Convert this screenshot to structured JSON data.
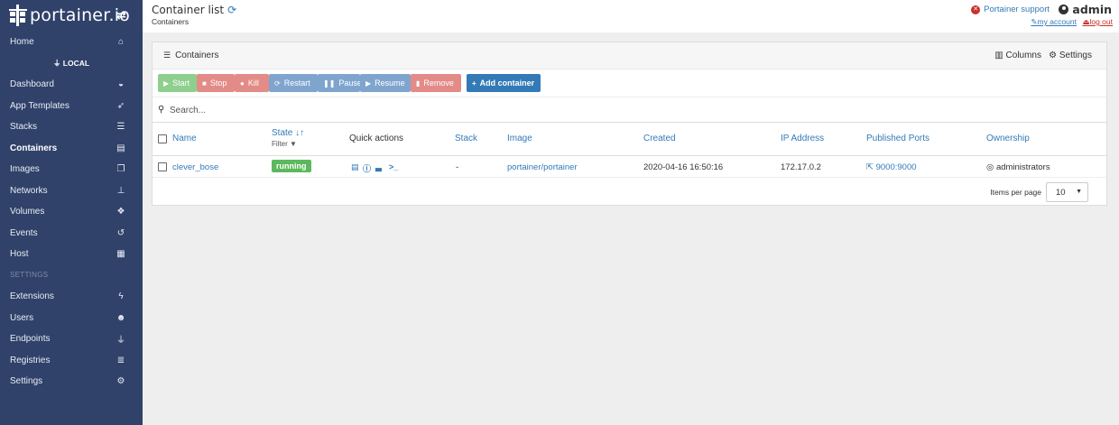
{
  "sidebar": {
    "brand": "portainer.io",
    "toggle_icon": "⇄",
    "endpoint": "LOCAL",
    "endpoint_icon": "plug-icon",
    "settings_heading": "SETTINGS",
    "items": [
      {
        "label": "Home",
        "icon": "home-icon",
        "glyph": "⌂"
      },
      {
        "label": "Dashboard",
        "icon": "tachometer-icon",
        "glyph": "◒"
      },
      {
        "label": "App Templates",
        "icon": "rocket-icon",
        "glyph": "➶"
      },
      {
        "label": "Stacks",
        "icon": "th-list-icon",
        "glyph": "☰"
      },
      {
        "label": "Containers",
        "icon": "server-icon",
        "glyph": "▤"
      },
      {
        "label": "Images",
        "icon": "clone-icon",
        "glyph": "❐"
      },
      {
        "label": "Networks",
        "icon": "sitemap-icon",
        "glyph": "⊥"
      },
      {
        "label": "Volumes",
        "icon": "cubes-icon",
        "glyph": "❖"
      },
      {
        "label": "Events",
        "icon": "history-icon",
        "glyph": "↺"
      },
      {
        "label": "Host",
        "icon": "th-icon",
        "glyph": "▦"
      },
      {
        "label": "Extensions",
        "icon": "bolt-icon",
        "glyph": "ϟ"
      },
      {
        "label": "Users",
        "icon": "users-icon",
        "glyph": "☻"
      },
      {
        "label": "Endpoints",
        "icon": "plug-icon",
        "glyph": "⏚"
      },
      {
        "label": "Registries",
        "icon": "database-icon",
        "glyph": "≣"
      },
      {
        "label": "Settings",
        "icon": "cogs-icon",
        "glyph": "⚙"
      }
    ]
  },
  "header": {
    "title": "Container list",
    "breadcrumb": "Containers",
    "support": "Portainer support",
    "user": "admin",
    "my_account": "my account",
    "log_out": "log out"
  },
  "panel": {
    "title": "Containers",
    "columns_label": "Columns",
    "settings_label": "Settings",
    "actions": {
      "start": "Start",
      "stop": "Stop",
      "kill": "Kill",
      "restart": "Restart",
      "pause": "Pause",
      "resume": "Resume",
      "remove": "Remove",
      "add": "Add container"
    },
    "search_placeholder": "Search...",
    "columns": {
      "name": "Name",
      "state": "State",
      "state_filter": "Filter",
      "quick_actions": "Quick actions",
      "stack": "Stack",
      "image": "Image",
      "created": "Created",
      "ip": "IP Address",
      "ports": "Published Ports",
      "ownership": "Ownership"
    },
    "rows": [
      {
        "name": "clever_bose",
        "state": "running",
        "stack": "-",
        "image": "portainer/portainer",
        "created": "2020-04-16 16:50:16",
        "ip": "172.17.0.2",
        "ports": "9000:9000",
        "ownership": "administrators"
      }
    ],
    "items_per_page_label": "Items per page",
    "items_per_page": "10"
  },
  "colors": {
    "sidebar": "#30426a",
    "link": "#337ab7",
    "running": "#5cb85c",
    "danger": "#c9302c"
  }
}
